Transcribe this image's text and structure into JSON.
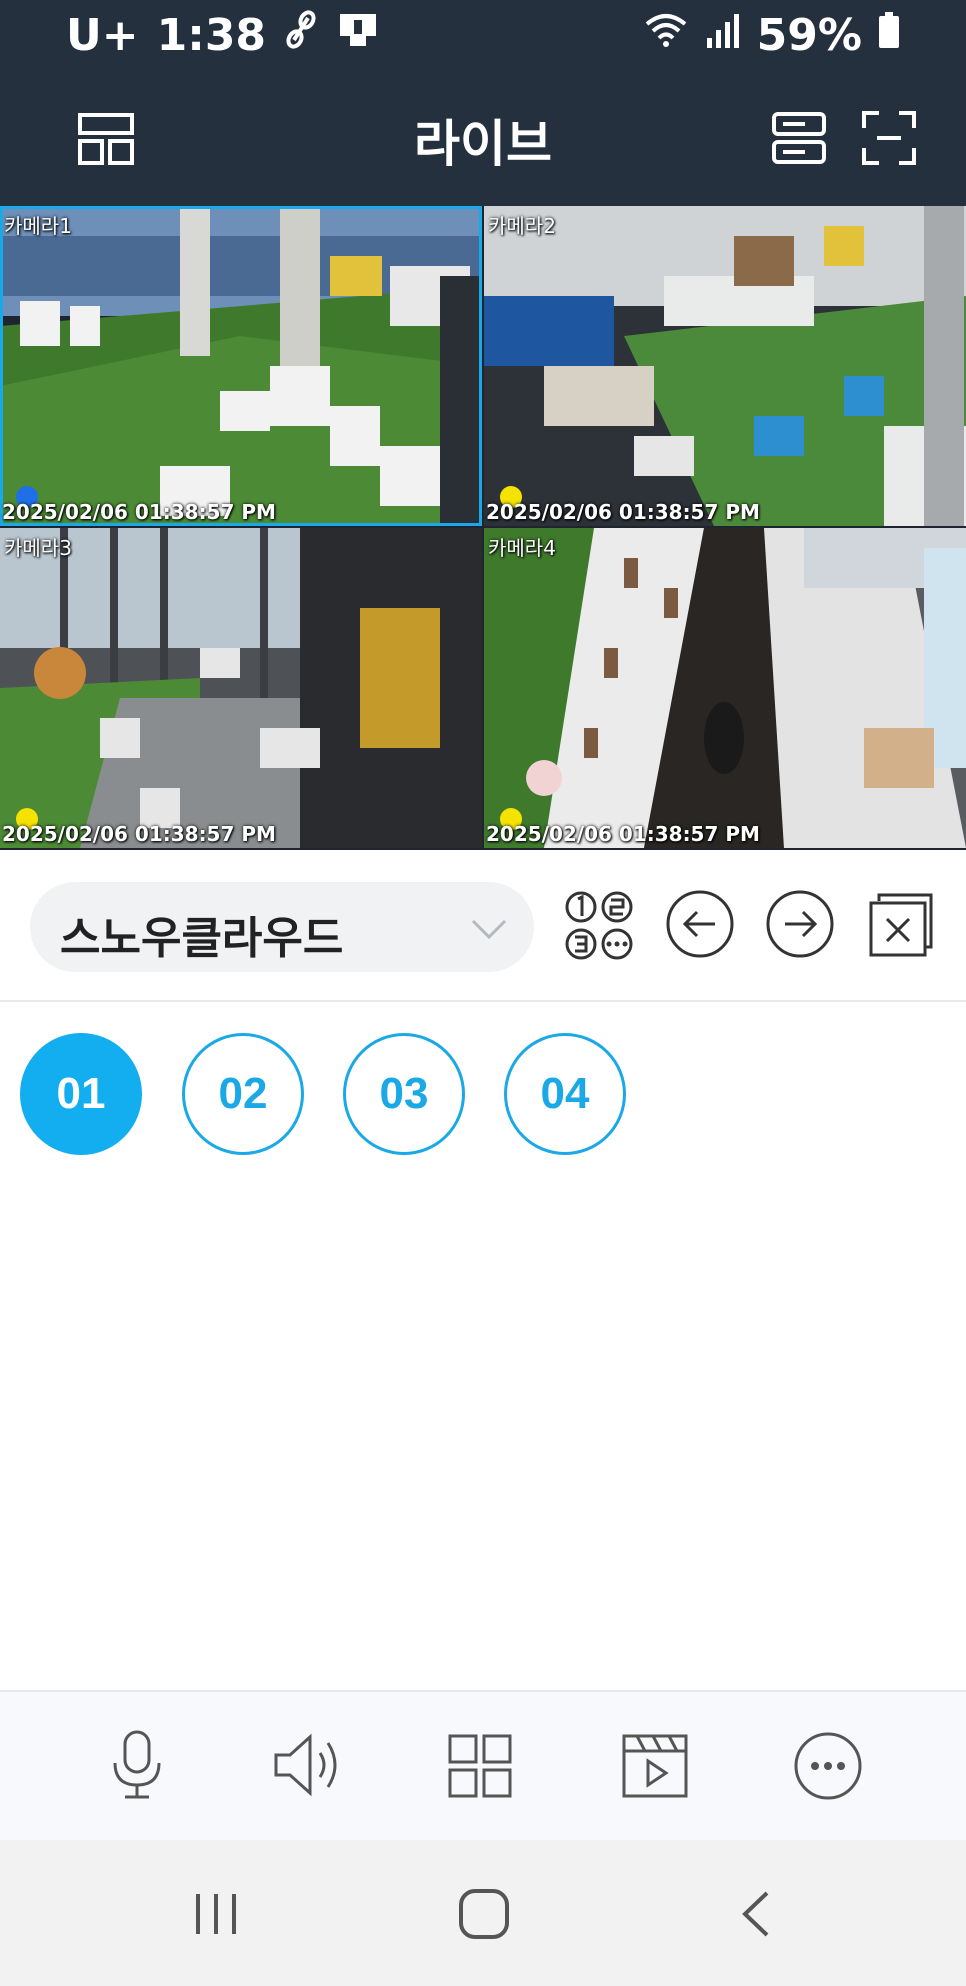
{
  "status": {
    "carrier": "U+",
    "time": "1:38",
    "battery": "59%"
  },
  "header": {
    "title": "라이브"
  },
  "cameras": [
    {
      "label": "카메라1",
      "timestamp": "2025/02/06 01:38:57 PM",
      "dot_color": "#1f6fe8"
    },
    {
      "label": "카메라2",
      "timestamp": "2025/02/06 01:38:57 PM",
      "dot_color": "#f4e200"
    },
    {
      "label": "카메라3",
      "timestamp": "2025/02/06 01:38:57 PM",
      "dot_color": "#f4e200"
    },
    {
      "label": "카메라4",
      "timestamp": "2025/02/06 01:38:57 PM",
      "dot_color": "#f4e200"
    }
  ],
  "site": {
    "name": "스노우클라우드"
  },
  "channels": [
    {
      "label": "01",
      "active": true
    },
    {
      "label": "02",
      "active": false
    },
    {
      "label": "03",
      "active": false
    },
    {
      "label": "04",
      "active": false
    }
  ],
  "colors": {
    "header_bg": "#25303f",
    "accent": "#12aef0"
  }
}
